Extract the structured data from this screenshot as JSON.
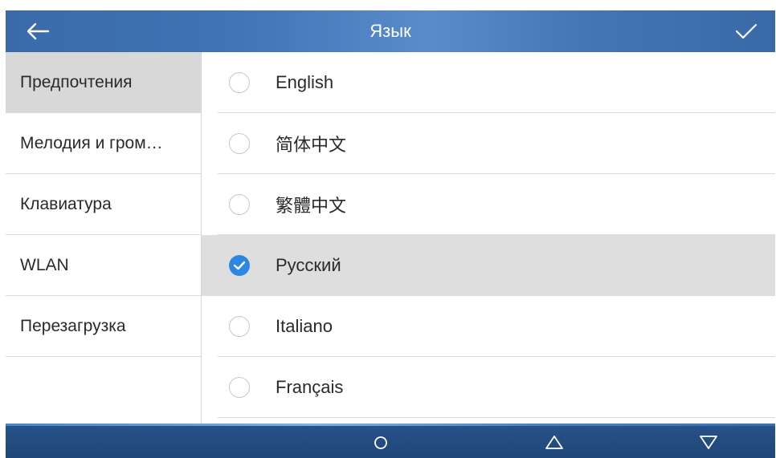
{
  "header": {
    "title": "Язык",
    "back_icon": "arrow-left-icon",
    "confirm_icon": "checkmark-icon",
    "colors": {
      "bar": "#3f74b6",
      "text": "#ffffff"
    }
  },
  "sidebar": {
    "items": [
      {
        "label": "Предпочтения",
        "active": true
      },
      {
        "label": "Мелодия и гром…",
        "active": false
      },
      {
        "label": "Клавиатура",
        "active": false
      },
      {
        "label": "WLAN",
        "active": false
      },
      {
        "label": "Перезагрузка",
        "active": false
      }
    ]
  },
  "languages": {
    "items": [
      {
        "label": "English",
        "selected": false
      },
      {
        "label": "简体中文",
        "selected": false
      },
      {
        "label": "繁體中文",
        "selected": false
      },
      {
        "label": "Русский",
        "selected": true
      },
      {
        "label": "Italiano",
        "selected": false
      },
      {
        "label": "Français",
        "selected": false
      }
    ],
    "colors": {
      "selected_radio": "#2d87e2",
      "selected_row": "#dedede"
    }
  },
  "navbar": {
    "buttons": [
      "circle-home-icon",
      "triangle-up-icon",
      "triangle-down-icon"
    ],
    "color": "#1f4678"
  }
}
